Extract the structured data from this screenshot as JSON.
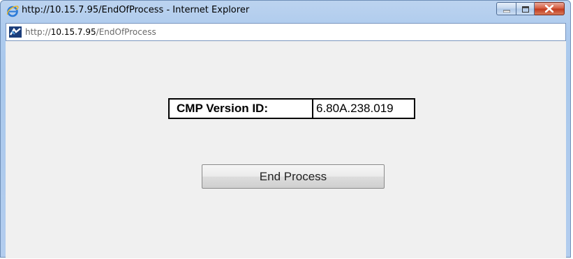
{
  "window": {
    "title": "http://10.15.7.95/EndOfProcess - Internet Explorer",
    "controls": {
      "minimize_icon": "minimize-icon",
      "maximize_icon": "maximize-icon",
      "close_icon": "close-icon"
    }
  },
  "address_bar": {
    "scheme": "http://",
    "host": "10.15.7.95",
    "path": "/EndOfProcess"
  },
  "page": {
    "version_label": "CMP Version ID:",
    "version_value": "6.80A.238.019",
    "end_button_label": "End Process"
  },
  "colors": {
    "content_bg": "#f0f0f0",
    "frame": "#a9c8ec",
    "close_button": "#c0381b"
  }
}
